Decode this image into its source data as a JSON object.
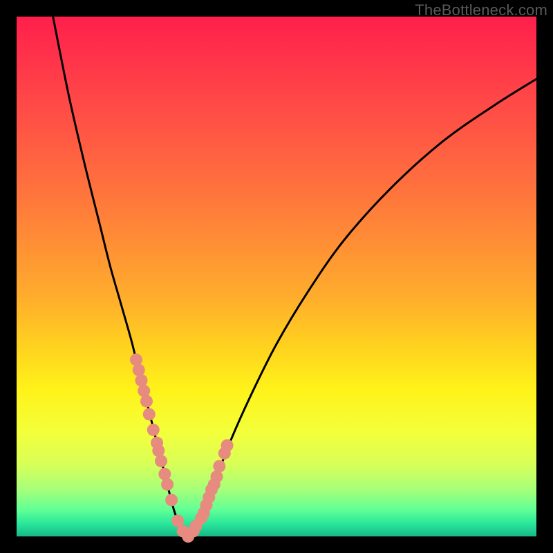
{
  "watermark": "TheBottleneck.com",
  "colors": {
    "curve": "#000000",
    "marker_fill": "#e78a80",
    "marker_stroke": "#d46a60"
  },
  "chart_data": {
    "type": "line",
    "title": "",
    "xlabel": "",
    "ylabel": "",
    "xlim": [
      0,
      100
    ],
    "ylim": [
      0,
      100
    ],
    "grid": false,
    "legend": false,
    "series": [
      {
        "name": "bottleneck-curve",
        "x": [
          7,
          10,
          13,
          16,
          18,
          20,
          22,
          23,
          24,
          25,
          26,
          27,
          28,
          29,
          30,
          31,
          32,
          33,
          34,
          36,
          38,
          41,
          45,
          50,
          56,
          63,
          72,
          82,
          92,
          100
        ],
        "y": [
          100,
          85,
          72,
          60,
          52,
          45,
          38,
          34,
          30,
          26,
          22,
          18,
          14,
          10,
          6,
          3,
          1,
          0,
          1,
          4,
          10,
          18,
          27,
          37,
          47,
          57,
          67,
          76,
          83,
          88
        ]
      }
    ],
    "markers": {
      "name": "highlighted-points",
      "x": [
        23.0,
        23.5,
        24.0,
        24.5,
        25.0,
        25.5,
        26.3,
        27.0,
        27.3,
        27.8,
        28.5,
        29.0,
        29.8,
        31.0,
        32.0,
        33.0,
        34.0,
        34.5,
        35.5,
        36.0,
        36.5,
        37.0,
        37.5,
        38.0,
        38.5,
        39.0,
        40.0,
        40.5
      ],
      "y": [
        34.0,
        32.0,
        30.0,
        28.0,
        26.0,
        23.5,
        20.5,
        18.0,
        16.5,
        14.5,
        12.0,
        10.0,
        7.0,
        3.0,
        1.0,
        0.0,
        1.0,
        2.0,
        3.5,
        4.5,
        6.0,
        7.5,
        9.0,
        10.0,
        11.5,
        13.5,
        16.0,
        17.5
      ]
    }
  }
}
